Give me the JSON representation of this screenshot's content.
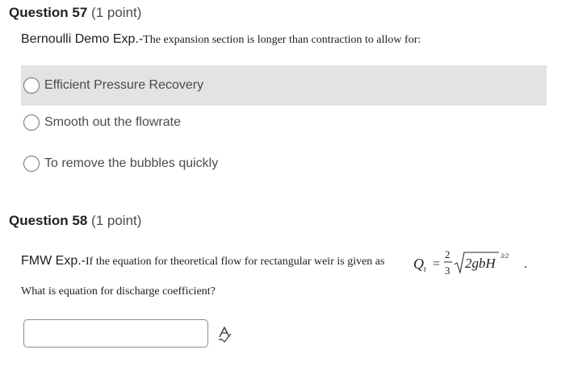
{
  "q57": {
    "number": "Question 57",
    "points": "(1 point)",
    "prompt_lead": "Bernoulli Demo Exp.-",
    "prompt_body": "The expansion section is longer than contraction to allow for:",
    "options": [
      {
        "label": "Efficient Pressure Recovery",
        "selected": false,
        "hovered": true
      },
      {
        "label": "Smooth out the flowrate",
        "selected": false
      },
      {
        "label": "To remove the bubbles quickly",
        "selected": false
      }
    ]
  },
  "q58": {
    "number": "Question 58",
    "points": "(1 point)",
    "prompt_lead": "FMW Exp.-",
    "prompt_body": "If the equation for theoretical flow for rectangular weir is given as",
    "formula": {
      "lhs": "Q",
      "lhs_sub": "t",
      "equals": "=",
      "frac_num": "2",
      "frac_den": "3",
      "radicand": "2gbH",
      "exponent": "3/2",
      "trailing": "."
    },
    "question": "What is equation for discharge coefficient?",
    "answer_value": ""
  },
  "icons": {
    "equation_editor": "equation-editor-icon"
  },
  "colors": {
    "hover_bg": "#e3e3e3",
    "text": "#494c4e",
    "title": "#202122",
    "border": "#6e7376"
  }
}
